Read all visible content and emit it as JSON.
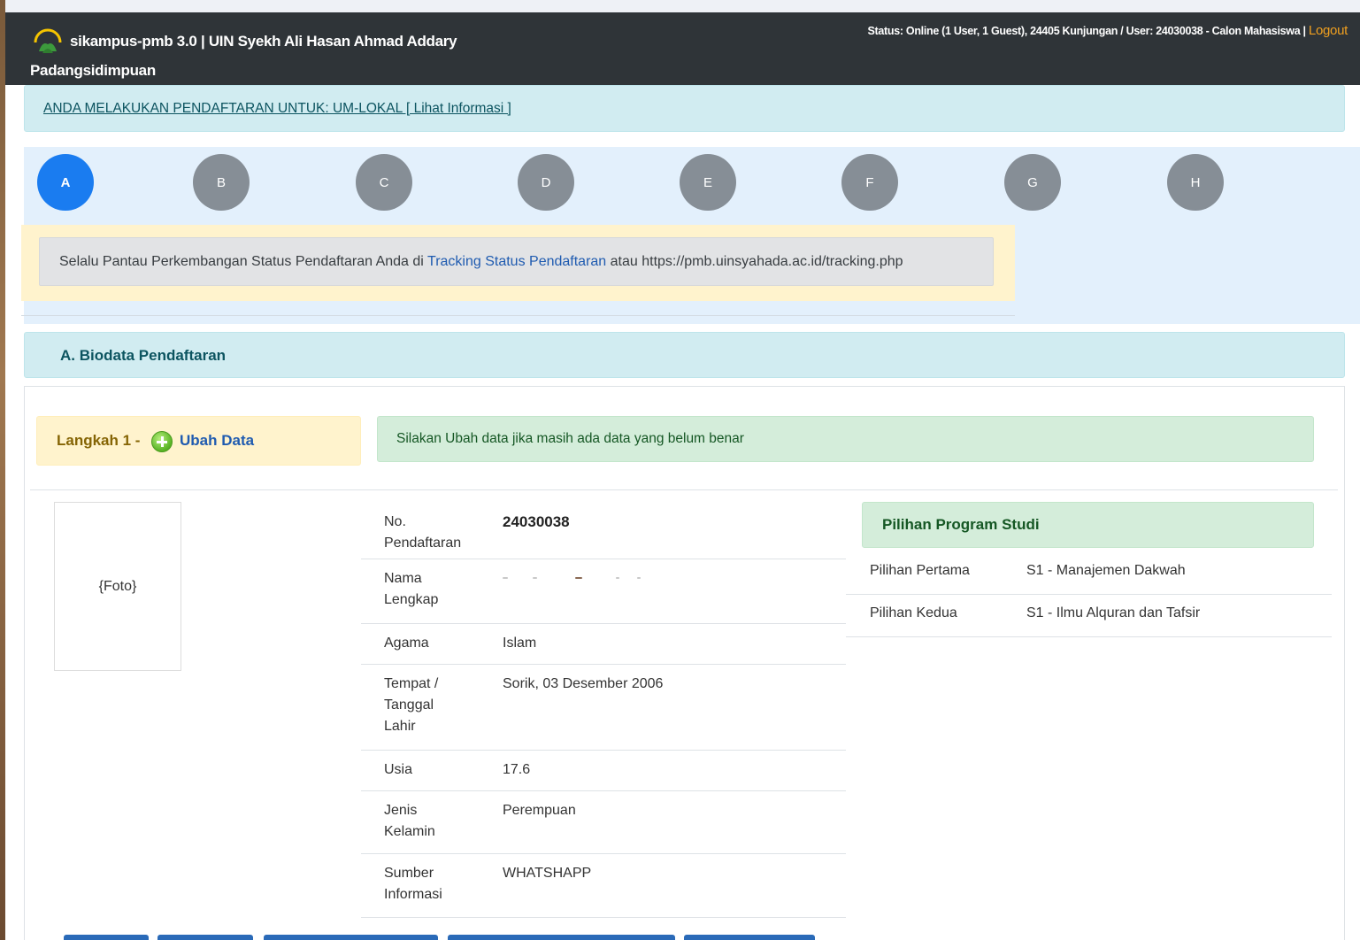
{
  "header": {
    "title_line1": "sikampus-pmb 3.0 | UIN Syekh Ali Hasan Ahmad Addary",
    "title_line2": "Padangsidimpuan",
    "status": "Status: Online (1 User, 1 Guest), 24405 Kunjungan / User: 24030038 - Calon Mahasiswa | ",
    "logout_label": "Logout"
  },
  "info_bar": {
    "text": "ANDA MELAKUKAN PENDAFTARAN UNTUK: UM-LOKAL [ Lihat Informasi ]"
  },
  "steps": [
    {
      "label": "A",
      "active": true
    },
    {
      "label": "B",
      "active": false
    },
    {
      "label": "C",
      "active": false
    },
    {
      "label": "D",
      "active": false
    },
    {
      "label": "E",
      "active": false
    },
    {
      "label": "F",
      "active": false
    },
    {
      "label": "G",
      "active": false
    },
    {
      "label": "H",
      "active": false
    }
  ],
  "alert": {
    "text_before": "Selalu Pantau Perkembangan Status Pendaftaran Anda di ",
    "link_text": "Tracking Status Pendaftaran",
    "text_after": " atau https://pmb.uinsyahada.ac.id/tracking.php"
  },
  "section": {
    "title": "A. Biodata Pendaftaran"
  },
  "step_box": {
    "label": "Langkah 1 -",
    "edit_label": "Ubah Data"
  },
  "success": {
    "text": "Silakan Ubah data jika masih ada data yang belum benar"
  },
  "photo": {
    "placeholder": "{Foto}"
  },
  "biodata": [
    {
      "label": "No. Pendaftaran",
      "value": "24030038"
    },
    {
      "label": "Nama Lengkap",
      "value": ""
    },
    {
      "label": "Agama",
      "value": "Islam"
    },
    {
      "label": "Tempat / Tanggal Lahir",
      "value": "Sorik, 03 Desember 2006"
    },
    {
      "label": "Usia",
      "value": "17.6"
    },
    {
      "label": "Jenis Kelamin",
      "value": "Perempuan"
    },
    {
      "label": "Sumber Informasi",
      "value": "WHATSHAPP"
    }
  ],
  "prodi": {
    "title": "Pilihan Program Studi",
    "rows": [
      {
        "label": "Pilihan Pertama",
        "value": "S1 - Manajemen Dakwah"
      },
      {
        "label": "Pilihan Kedua",
        "value": "S1 - Ilmu Alquran dan Tafsir"
      }
    ]
  },
  "colors": {
    "header_bg": "#2f3438",
    "step_active": "#1a7cf0",
    "step_inactive": "#868e96",
    "link": "#1f5bb0",
    "logout": "#f0a020",
    "button_primary": "#2a6ab8"
  }
}
